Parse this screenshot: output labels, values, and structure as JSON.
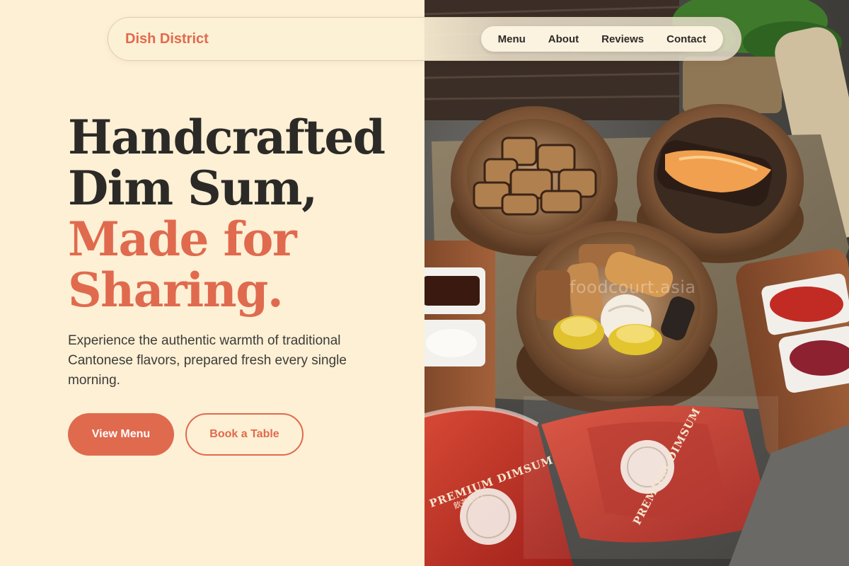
{
  "nav": {
    "brand": "Dish District",
    "links": [
      "Menu",
      "About",
      "Reviews",
      "Contact"
    ]
  },
  "hero": {
    "headline_line1": "Handcrafted",
    "headline_line2": "Dim Sum,",
    "headline_accent1": "Made for",
    "headline_accent2": "Sharing.",
    "description": "Experience the authentic warmth of traditional Cantonese flavors, prepared fresh every single morning.",
    "primary_cta": "View Menu",
    "secondary_cta": "Book a Table"
  },
  "photo": {
    "watermark": "foodcourt.asia",
    "package_label_1": "PREMIUM DIMSUM",
    "package_label_2": "PREMIUM DIMSUM",
    "package_sub": "飲茶點心"
  },
  "colors": {
    "accent": "#e06a4e",
    "background": "#fdf0d5",
    "text_dark": "#2c2a27"
  }
}
